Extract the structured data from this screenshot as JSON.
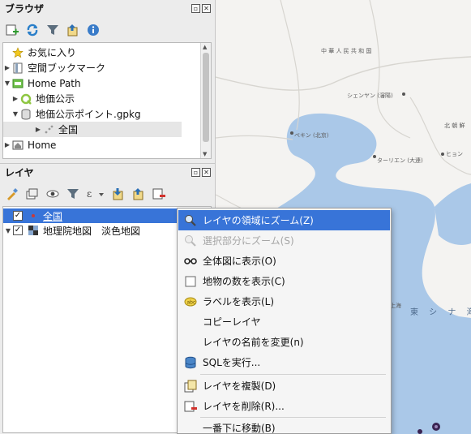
{
  "browser": {
    "title": "ブラウザ",
    "toolbar_icons": [
      "add-layer-icon",
      "refresh-icon",
      "filter-icon",
      "collapse-icon",
      "info-icon"
    ],
    "items": [
      {
        "label": "お気に入り",
        "icon": "star-icon"
      },
      {
        "label": "空間ブックマーク",
        "icon": "bookmark-icon"
      },
      {
        "label": "Home Path",
        "icon": "folder-icon"
      },
      {
        "label": "地価公示",
        "icon": "qgis-project-icon"
      },
      {
        "label": "地価公示ポイント.gpkg",
        "icon": "database-icon"
      },
      {
        "label": "全国",
        "icon": "point-layer-icon"
      },
      {
        "label": "Home",
        "icon": "home-icon"
      }
    ]
  },
  "layers": {
    "title": "レイヤ",
    "toolbar_icons": [
      "style-icon",
      "add-group-icon",
      "visibility-icon",
      "filter-icon",
      "expression-filter-icon",
      "expand-icon",
      "collapse-icon",
      "remove-layer-icon"
    ],
    "items": [
      {
        "label": "全国",
        "checked": true,
        "selected": true
      },
      {
        "label": "地理院地図　淡色地図",
        "checked": true,
        "selected": false
      }
    ]
  },
  "context_menu": {
    "items": [
      {
        "label": "レイヤの領域にズーム(Z)",
        "icon": "zoom-layer-icon",
        "highlighted": true
      },
      {
        "label": "選択部分にズーム(S)",
        "icon": "zoom-selection-icon",
        "disabled": true
      },
      {
        "label": "全体図に表示(O)",
        "icon": "overview-icon"
      },
      {
        "label": "地物の数を表示(C)",
        "icon": "checkbox-icon"
      },
      {
        "label": "ラベルを表示(L)",
        "icon": "label-icon"
      },
      {
        "label": "コピーレイヤ",
        "icon": ""
      },
      {
        "label": "レイヤの名前を変更(n)",
        "icon": ""
      },
      {
        "label": "SQLを実行...",
        "icon": "sql-icon"
      },
      {
        "label": "レイヤを複製(D)",
        "icon": "duplicate-icon"
      },
      {
        "label": "レイヤを削除(R)...",
        "icon": "remove-icon"
      },
      {
        "label": "一番下に移動(B)",
        "icon": ""
      }
    ]
  },
  "map": {
    "labels": [
      "中 華 人 民 共 和 国",
      "シェンヤン (瀋陽)",
      "北 朝 鮮",
      "ペキン (北京)",
      "ヒョン",
      "ターリエン (大連)",
      "上海",
      "東 シ ナ 海"
    ],
    "colors": {
      "land": "#f4f3f1",
      "water": "#aac8e8",
      "roads": "#d7d5d0",
      "point": "#3a2452"
    }
  }
}
